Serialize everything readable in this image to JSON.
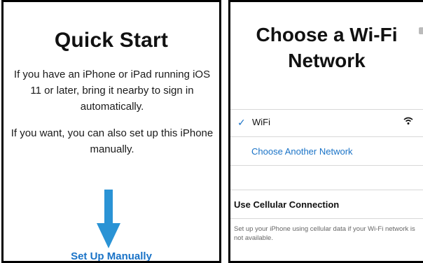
{
  "quick_start": {
    "title": "Quick Start",
    "paragraph1": "If you have an iPhone or iPad running iOS 11 or later, bring it nearby to sign in automatically.",
    "paragraph2": "If you want, you can also set up this iPhone manually.",
    "setup_link": "Set Up Manually",
    "arrow_color": "#2a93d5"
  },
  "wifi": {
    "title": "Choose a Wi-Fi Network",
    "network": {
      "name": "WiFi",
      "selected": true,
      "icon": "wifi-signal-icon"
    },
    "other_network": "Choose Another Network",
    "cellular_label": "Use Cellular Connection",
    "cellular_note": "Set up your iPhone using cellular data if your Wi-Fi network is not available."
  },
  "colors": {
    "accent": "#1a73c7",
    "border": "#000000"
  }
}
